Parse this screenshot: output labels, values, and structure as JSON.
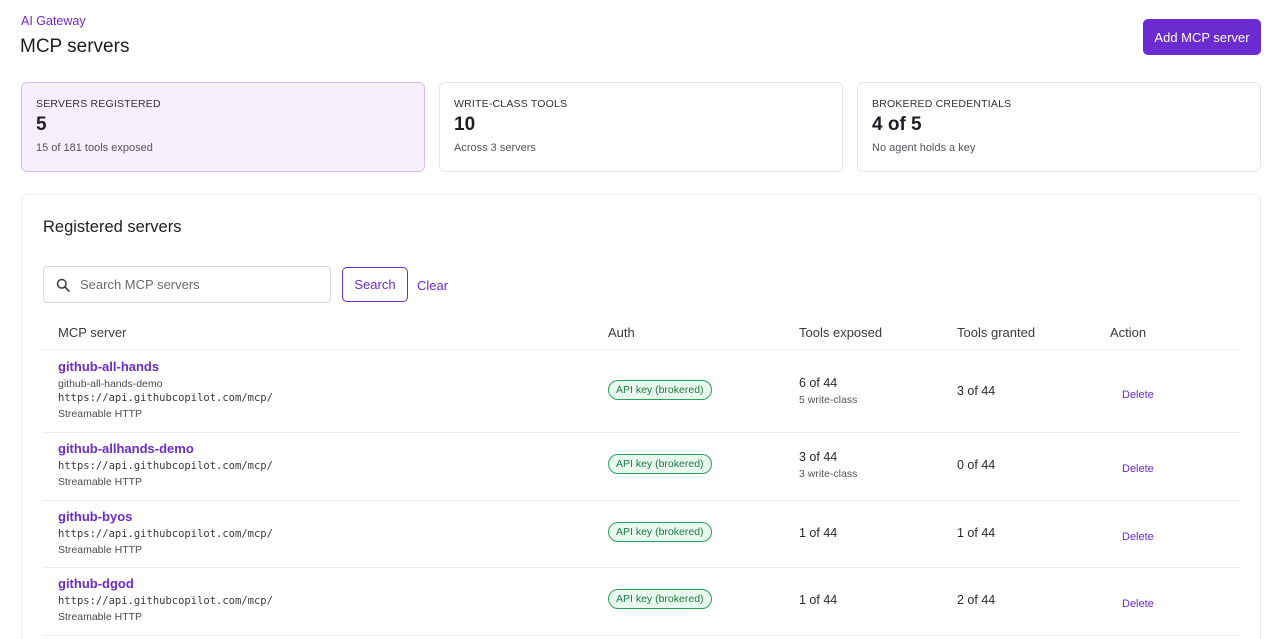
{
  "header": {
    "breadcrumb": "AI Gateway",
    "title": "MCP servers",
    "add_button_label": "Add MCP server"
  },
  "stats": [
    {
      "label": "SERVERS REGISTERED",
      "value": "5",
      "sub": "15 of 181 tools exposed",
      "active": true
    },
    {
      "label": "WRITE-CLASS TOOLS",
      "value": "10",
      "sub": "Across 3 servers",
      "active": false
    },
    {
      "label": "BROKERED CREDENTIALS",
      "value": "4 of 5",
      "sub": "No agent holds a key",
      "active": false
    }
  ],
  "panel": {
    "title": "Registered servers",
    "search": {
      "placeholder": "Search MCP servers",
      "value": "",
      "icon": "search-icon"
    },
    "search_button_label": "Search",
    "clear_label": "Clear",
    "columns": [
      "MCP server",
      "Auth",
      "Tools exposed",
      "Tools granted",
      "Action"
    ],
    "rows": [
      {
        "name": "github-all-hands",
        "alias": "github-all-hands-demo",
        "url": "https://api.githubcopilot.com/mcp/",
        "transport": "Streamable HTTP",
        "auth": "API key (brokered)",
        "tools_exposed": "6 of 44",
        "tools_exposed_sub": "5 write-class",
        "tools_granted": "3 of 44",
        "action": "Delete"
      },
      {
        "name": "github-allhands-demo",
        "alias": "",
        "url": "https://api.githubcopilot.com/mcp/",
        "transport": "Streamable HTTP",
        "auth": "API key (brokered)",
        "tools_exposed": "3 of 44",
        "tools_exposed_sub": "3 write-class",
        "tools_granted": "0 of 44",
        "action": "Delete"
      },
      {
        "name": "github-byos",
        "alias": "",
        "url": "https://api.githubcopilot.com/mcp/",
        "transport": "Streamable HTTP",
        "auth": "API key (brokered)",
        "tools_exposed": "1 of 44",
        "tools_exposed_sub": "",
        "tools_granted": "1 of 44",
        "action": "Delete"
      },
      {
        "name": "github-dgod",
        "alias": "",
        "url": "https://api.githubcopilot.com/mcp/",
        "transport": "Streamable HTTP",
        "auth": "API key (brokered)",
        "tools_exposed": "1 of 44",
        "tools_exposed_sub": "",
        "tools_granted": "2 of 44",
        "action": "Delete"
      }
    ]
  },
  "colors": {
    "accent": "#6b2bd1",
    "active_card_bg": "#f6effe",
    "badge_green": "#2aa15a"
  }
}
